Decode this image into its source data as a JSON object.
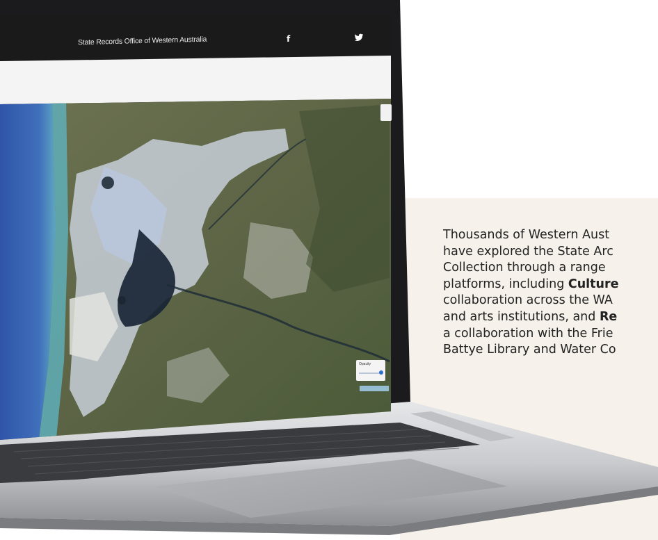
{
  "site": {
    "title": "State Records Office of Western Australia",
    "social_icons": [
      "facebook-icon",
      "twitter-icon"
    ]
  },
  "map": {
    "opacity_label": "Opacity",
    "opacity_value": 1.0
  },
  "blurb": {
    "line1": "Thousands of Western Aust",
    "line2": "have explored the State Arc",
    "line3": "Collection through a range",
    "line4_prefix": "platforms, including ",
    "line4_bold": "Culture",
    "line5": "collaboration across the WA",
    "line6_prefix": "and arts institutions, and ",
    "line6_bold": "Re",
    "line7": "a collaboration with the Frie",
    "line8": "Battye Library and Water Co"
  },
  "colors": {
    "background": "#ffffff",
    "panel_beige": "#f6f1ea",
    "header_bar": "#1a1a1a",
    "text": "#222222"
  }
}
